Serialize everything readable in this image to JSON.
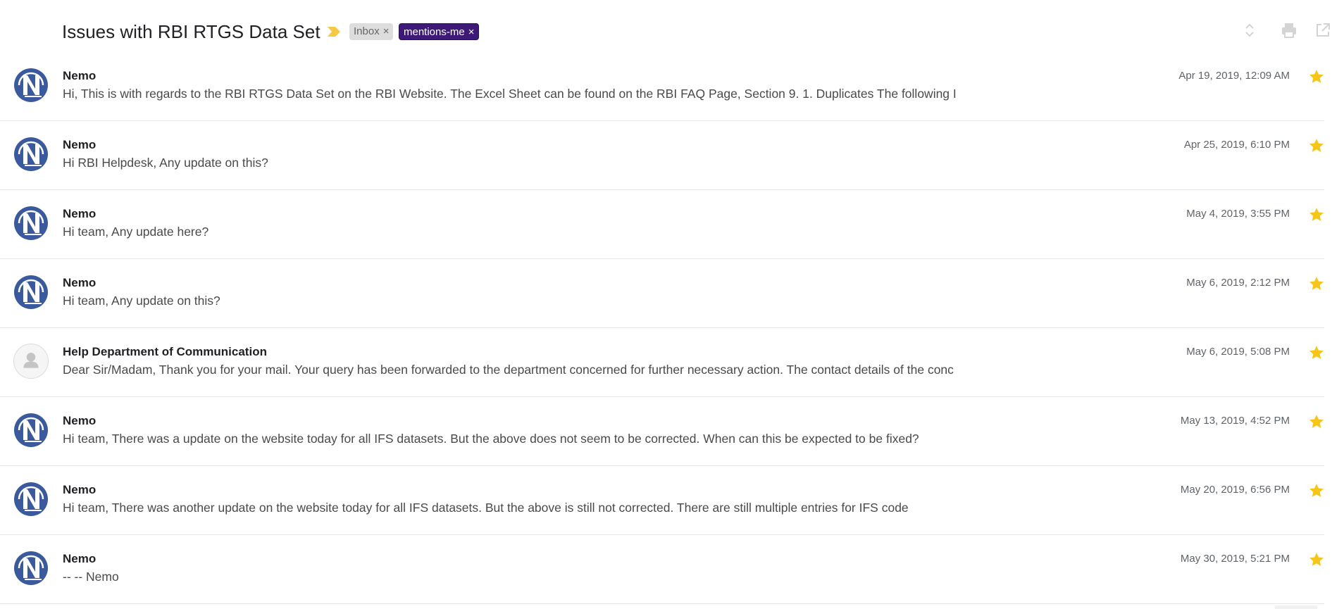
{
  "thread": {
    "subject": "Issues with RBI RTGS Data Set",
    "labels": [
      {
        "name": "Inbox",
        "close": "×"
      },
      {
        "name": "mentions-me",
        "close": "×"
      }
    ]
  },
  "colors": {
    "star": "#f5c518",
    "importance": "#f6c945",
    "mentions_chip": "#3d1a78",
    "inbox_chip": "#dddddd",
    "avatar_brand": "#3b5a9d"
  },
  "header_icons": [
    "expand-collapse-icon",
    "print-icon",
    "open-in-new-window-icon"
  ],
  "messages": [
    {
      "sender": "Nemo",
      "avatar": "nemo-logo",
      "date": "Apr 19, 2019, 12:09 AM",
      "snippet": "Hi, This is with regards to the RBI RTGS Data Set on the RBI Website. The Excel Sheet can be found on the RBI FAQ Page, Section 9. 1. Duplicates The following I",
      "starred": true
    },
    {
      "sender": "Nemo",
      "avatar": "nemo-logo",
      "date": "Apr 25, 2019, 6:10 PM",
      "snippet": "Hi RBI Helpdesk, Any update on this?",
      "starred": true
    },
    {
      "sender": "Nemo",
      "avatar": "nemo-logo",
      "date": "May 4, 2019, 3:55 PM",
      "snippet": "Hi team, Any update here?",
      "starred": true
    },
    {
      "sender": "Nemo",
      "avatar": "nemo-logo",
      "date": "May 6, 2019, 2:12 PM",
      "snippet": "Hi team, Any update on this?",
      "starred": true
    },
    {
      "sender": "Help Department of Communication",
      "avatar": "generic-person",
      "date": "May 6, 2019, 5:08 PM",
      "snippet": "Dear Sir/Madam, Thank you for your mail. Your query has been forwarded to the department concerned for further necessary action. The contact details of the conc",
      "starred": true
    },
    {
      "sender": "Nemo",
      "avatar": "nemo-logo",
      "date": "May 13, 2019, 4:52 PM",
      "snippet": "Hi team, There was a update on the website today for all IFS datasets. But the above does not seem to be corrected. When can this be expected to be fixed?",
      "starred": true
    },
    {
      "sender": "Nemo",
      "avatar": "nemo-logo",
      "date": "May 20, 2019, 6:56 PM",
      "snippet": "Hi team, There was another update on the website today for all IFS datasets. But the above is still not corrected. There are still multiple entries for IFS code",
      "starred": true
    },
    {
      "sender": "Nemo",
      "avatar": "nemo-logo",
      "date": "May 30, 2019, 5:21 PM",
      "snippet": "-- -- Nemo",
      "starred": true
    }
  ]
}
